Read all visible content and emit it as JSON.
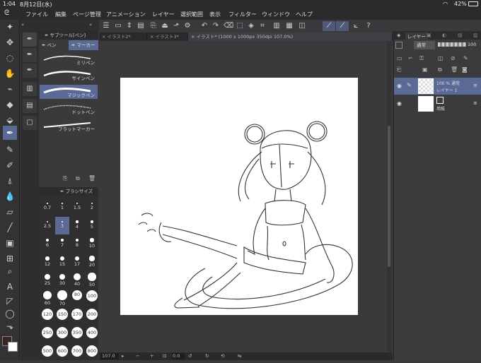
{
  "status": {
    "time": "1:04",
    "date": "8月12日(水)",
    "battery": "42%"
  },
  "menu": [
    "ファイル",
    "編集",
    "ページ管理",
    "アニメーション",
    "レイヤー",
    "選択範囲",
    "表示",
    "フィルター",
    "ウィンドウ",
    "ヘルプ"
  ],
  "tabs": [
    "イラスト2*",
    "イラスト3*",
    "イラスト* (1000 x 1000px 350dpi 107.0%)"
  ],
  "subtool": {
    "header": "サブツール[ペン]",
    "groups": [
      "ペン",
      "マーカー"
    ],
    "brushes": [
      "ミリペン",
      "サインペン",
      "マジックペン",
      "ドットペン",
      "フラットマーカー"
    ],
    "active_brush": "マジックペン"
  },
  "brush_size": {
    "header": "ブラシサイズ",
    "values": [
      "0.7",
      "1",
      "1.5",
      "2",
      "2.5",
      "3",
      "4",
      "5",
      "6",
      "7",
      "8",
      "10",
      "12",
      "15",
      "17",
      "20",
      "25",
      "30",
      "40",
      "50",
      "60",
      "70",
      "80",
      "100",
      "120",
      "150",
      "170",
      "200",
      "250",
      "300",
      "350",
      "400",
      "500",
      "600",
      "700",
      "800"
    ],
    "selected": "3"
  },
  "layers": {
    "header": "レイヤー",
    "blend": "通常",
    "opacity": "100",
    "items": [
      {
        "line1": "100 % 通常",
        "line2": "レイヤー 1"
      },
      {
        "line1": "",
        "line2": "用紙"
      }
    ]
  },
  "bottom": {
    "zoom": "107.0",
    "rotation": "0.0"
  },
  "colors": {
    "accent": "#5a6a95",
    "main_color": "#3a2424",
    "sub_color": "#ffffff"
  }
}
